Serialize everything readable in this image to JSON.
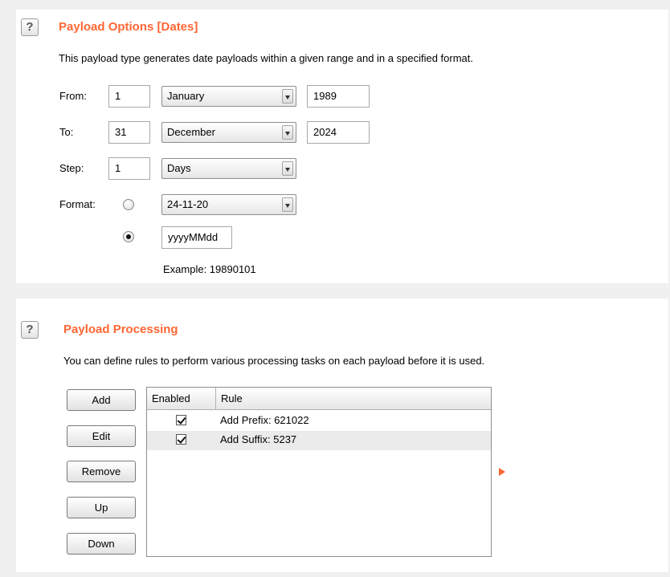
{
  "payload_options": {
    "help_glyph": "?",
    "title": "Payload Options [Dates]",
    "description": "This payload type generates date payloads within a given range and in a specified format.",
    "from": {
      "label": "From:",
      "day": "1",
      "month": "January",
      "year": "1989"
    },
    "to": {
      "label": "To:",
      "day": "31",
      "month": "December",
      "year": "2024"
    },
    "step": {
      "label": "Step:",
      "value": "1",
      "unit": "Days"
    },
    "format": {
      "label": "Format:",
      "preset_value": "24-11-20",
      "custom_value": "yyyyMMdd",
      "preset_selected": false,
      "custom_selected": true,
      "example": "Example: 19890101"
    }
  },
  "payload_processing": {
    "help_glyph": "?",
    "title": "Payload Processing",
    "description": "You can define rules to perform various processing tasks on each payload before it is used.",
    "buttons": {
      "add": "Add",
      "edit": "Edit",
      "remove": "Remove",
      "up": "Up",
      "down": "Down"
    },
    "table": {
      "columns": [
        "Enabled",
        "Rule"
      ],
      "rows": [
        {
          "enabled": true,
          "rule": "Add Prefix: 621022"
        },
        {
          "enabled": true,
          "rule": "Add Suffix: 5237"
        }
      ]
    }
  },
  "colors": {
    "accent": "#ff6633",
    "panel_bg": "#ffffff",
    "window_bg": "#f0f0f0"
  },
  "icons": {
    "help": "help-icon",
    "expand": "play-arrow-icon"
  }
}
